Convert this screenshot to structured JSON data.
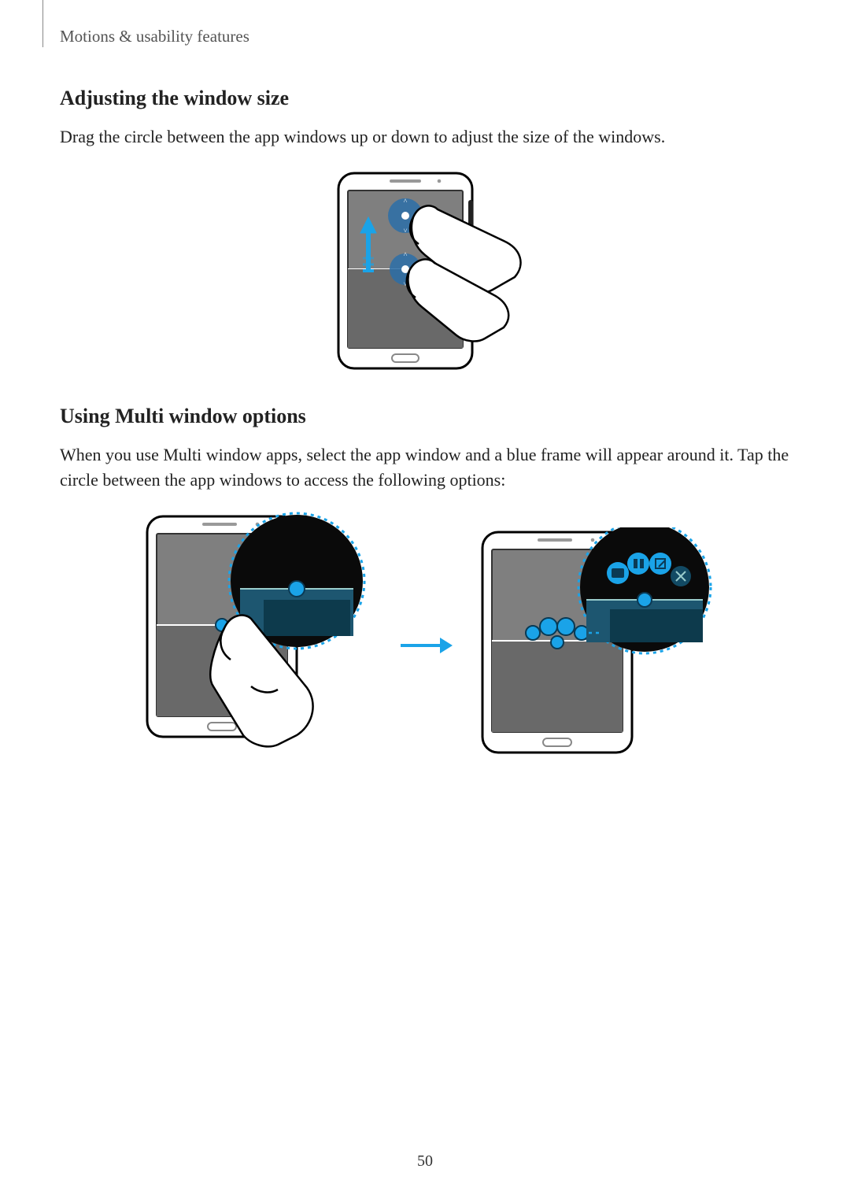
{
  "header": {
    "section": "Motions & usability features"
  },
  "section1": {
    "heading": "Adjusting the window size",
    "body": "Drag the circle between the app windows up or down to adjust the size of the windows."
  },
  "section2": {
    "heading": "Using Multi window options",
    "body": "When you use Multi window apps, select the app window and a blue frame will appear around it. Tap the circle between the app windows to access the following options:"
  },
  "pageNumber": "50"
}
